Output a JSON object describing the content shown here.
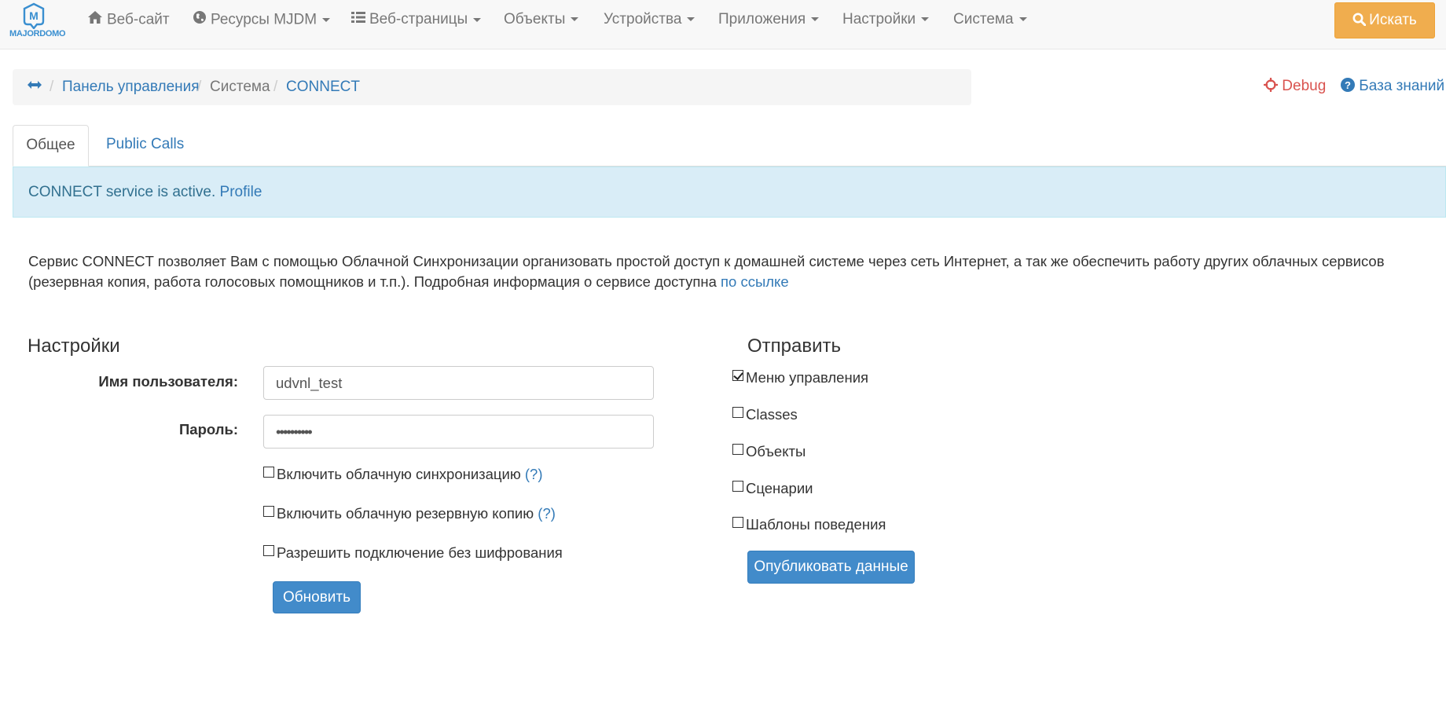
{
  "navbar": {
    "logo_text": "MAJORDOMO",
    "items": [
      {
        "label": "Веб-сайт",
        "icon": "home-icon",
        "dropdown": false
      },
      {
        "label": "Ресурсы MJDM",
        "icon": "globe-icon",
        "dropdown": true
      },
      {
        "label": "Веб-страницы",
        "icon": "list-icon",
        "dropdown": true
      },
      {
        "label": "Объекты",
        "dropdown": true
      },
      {
        "label": "Устройства",
        "dropdown": true
      },
      {
        "label": "Приложения",
        "dropdown": true
      },
      {
        "label": "Настройки",
        "dropdown": true
      },
      {
        "label": "Система",
        "dropdown": true
      }
    ],
    "search_label": "Искать"
  },
  "breadcrumb": {
    "items": [
      "Панель управления",
      "Система",
      "CONNECT"
    ],
    "debug_label": "Debug",
    "kb_label": "База знаний"
  },
  "tabs": [
    {
      "label": "Общее",
      "active": true
    },
    {
      "label": "Public Calls",
      "active": false
    }
  ],
  "alert": {
    "text": "CONNECT service is active. ",
    "link": "Profile"
  },
  "description": {
    "text": "Сервис CONNECT позволяет Вам с помощью Облачной Синхронизации организовать простой доступ к домашней системе через сеть Интернет, а так же обеспечить работу других облачных сервисов (резервная копия, работа голосовых помощников и т.п.). Подробная информация о сервисе доступна ",
    "link": "по ссылке"
  },
  "settings": {
    "title": "Настройки",
    "username_label": "Имя пользователя:",
    "username_value": "udvnl_test",
    "password_label": "Пароль:",
    "password_value": "••••••••••",
    "options": [
      {
        "label": "Включить облачную синхронизацию",
        "help": "(?)",
        "checked": false
      },
      {
        "label": "Включить облачную резервную копию",
        "help": "(?)",
        "checked": false
      },
      {
        "label": "Разрешить подключение без шифрования",
        "help": "",
        "checked": false
      }
    ],
    "update_button": "Обновить"
  },
  "send": {
    "title": "Отправить",
    "options": [
      {
        "label": "Меню управления",
        "checked": true
      },
      {
        "label": "Classes",
        "checked": false
      },
      {
        "label": "Объекты",
        "checked": false
      },
      {
        "label": "Сценарии",
        "checked": false
      },
      {
        "label": "Шаблоны поведения",
        "checked": false
      }
    ],
    "publish_button": "Опубликовать данные"
  },
  "colors": {
    "primary": "#428bca",
    "warning": "#f0ad4e",
    "link": "#337ab7",
    "danger": "#d9534f",
    "alert_bg": "#d9edf7"
  }
}
